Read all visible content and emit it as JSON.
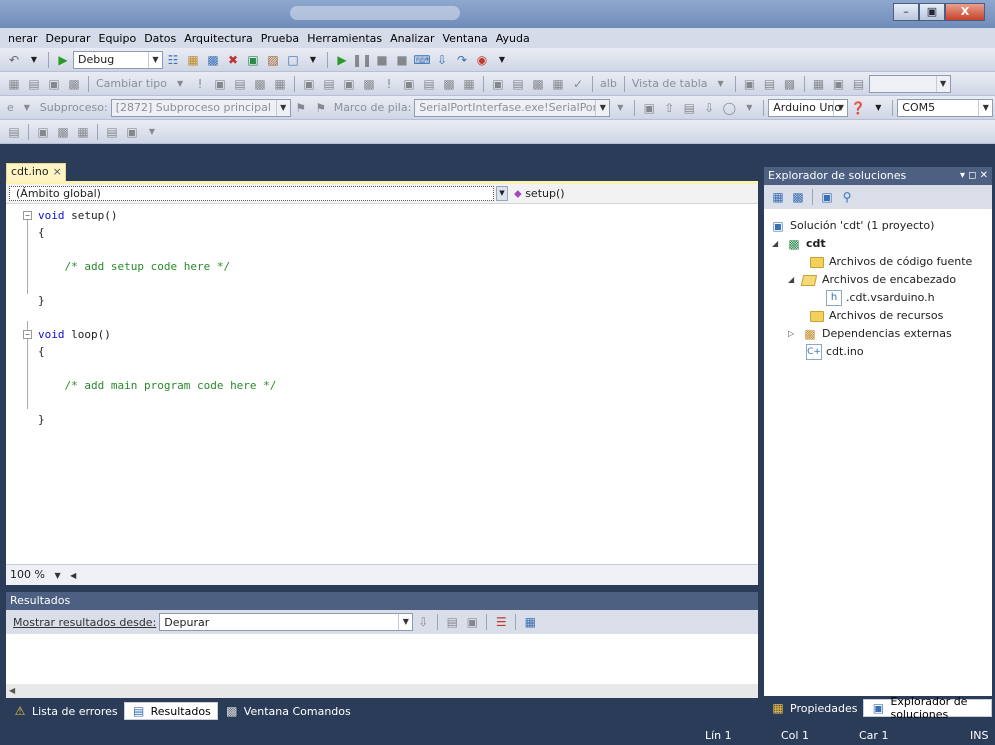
{
  "menu": [
    "nerar",
    "Depurar",
    "Equipo",
    "Datos",
    "Arquitectura",
    "Prueba",
    "Herramientas",
    "Analizar",
    "Ventana",
    "Ayuda"
  ],
  "toolbar": {
    "config_value": "Debug",
    "cambiar_tipo": "Cambiar tipo",
    "alb": "alb",
    "vista_tabla": "Vista de tabla",
    "subproceso_label": "Subproceso:",
    "subproceso_value": "[2872] Subproceso principal",
    "marco_label": "Marco de pila:",
    "marco_value": "SerialPortInterfase.exe!SerialPortInterfase.f",
    "board_value": "Arduino Uno",
    "port_value": "COM5",
    "left_fragment": "e"
  },
  "editor": {
    "tab_label": "cdt.ino",
    "tab_close": "×",
    "scope": "(Ámbito global)",
    "member": "setup()",
    "zoom": "100 %"
  },
  "code": {
    "void": "void",
    "setup": "setup()",
    "loop": "loop()",
    "open": "{",
    "close": "}",
    "setup_comment": "/* add setup code here */",
    "loop_comment": "/* add main program code here */"
  },
  "results": {
    "title": "Resultados",
    "show_label": "Mostrar resultados desde:",
    "show_value": "Depurar"
  },
  "bottom_tabs": [
    "Lista de errores",
    "Resultados",
    "Ventana Comandos"
  ],
  "solution": {
    "title": "Explorador de soluciones",
    "controls": "▾ ◻ ✕",
    "root": "Solución 'cdt' (1 proyecto)",
    "project": "cdt",
    "source_folder": "Archivos de código fuente",
    "header_folder": "Archivos de encabezado",
    "header_file": ".cdt.vsarduino.h",
    "resource_folder": "Archivos de recursos",
    "deps": "Dependencias externas",
    "ino_file": "cdt.ino",
    "tab_props": "Propiedades",
    "tab_explorer": "Explorador de soluciones"
  },
  "status": {
    "lin": "Lín 1",
    "col": "Col 1",
    "car": "Car 1",
    "mode": "INS"
  },
  "colors": {
    "accent": "#4d6082",
    "background": "#2b3c59",
    "keyword": "#1010d0",
    "comment": "#2b8a2b"
  }
}
